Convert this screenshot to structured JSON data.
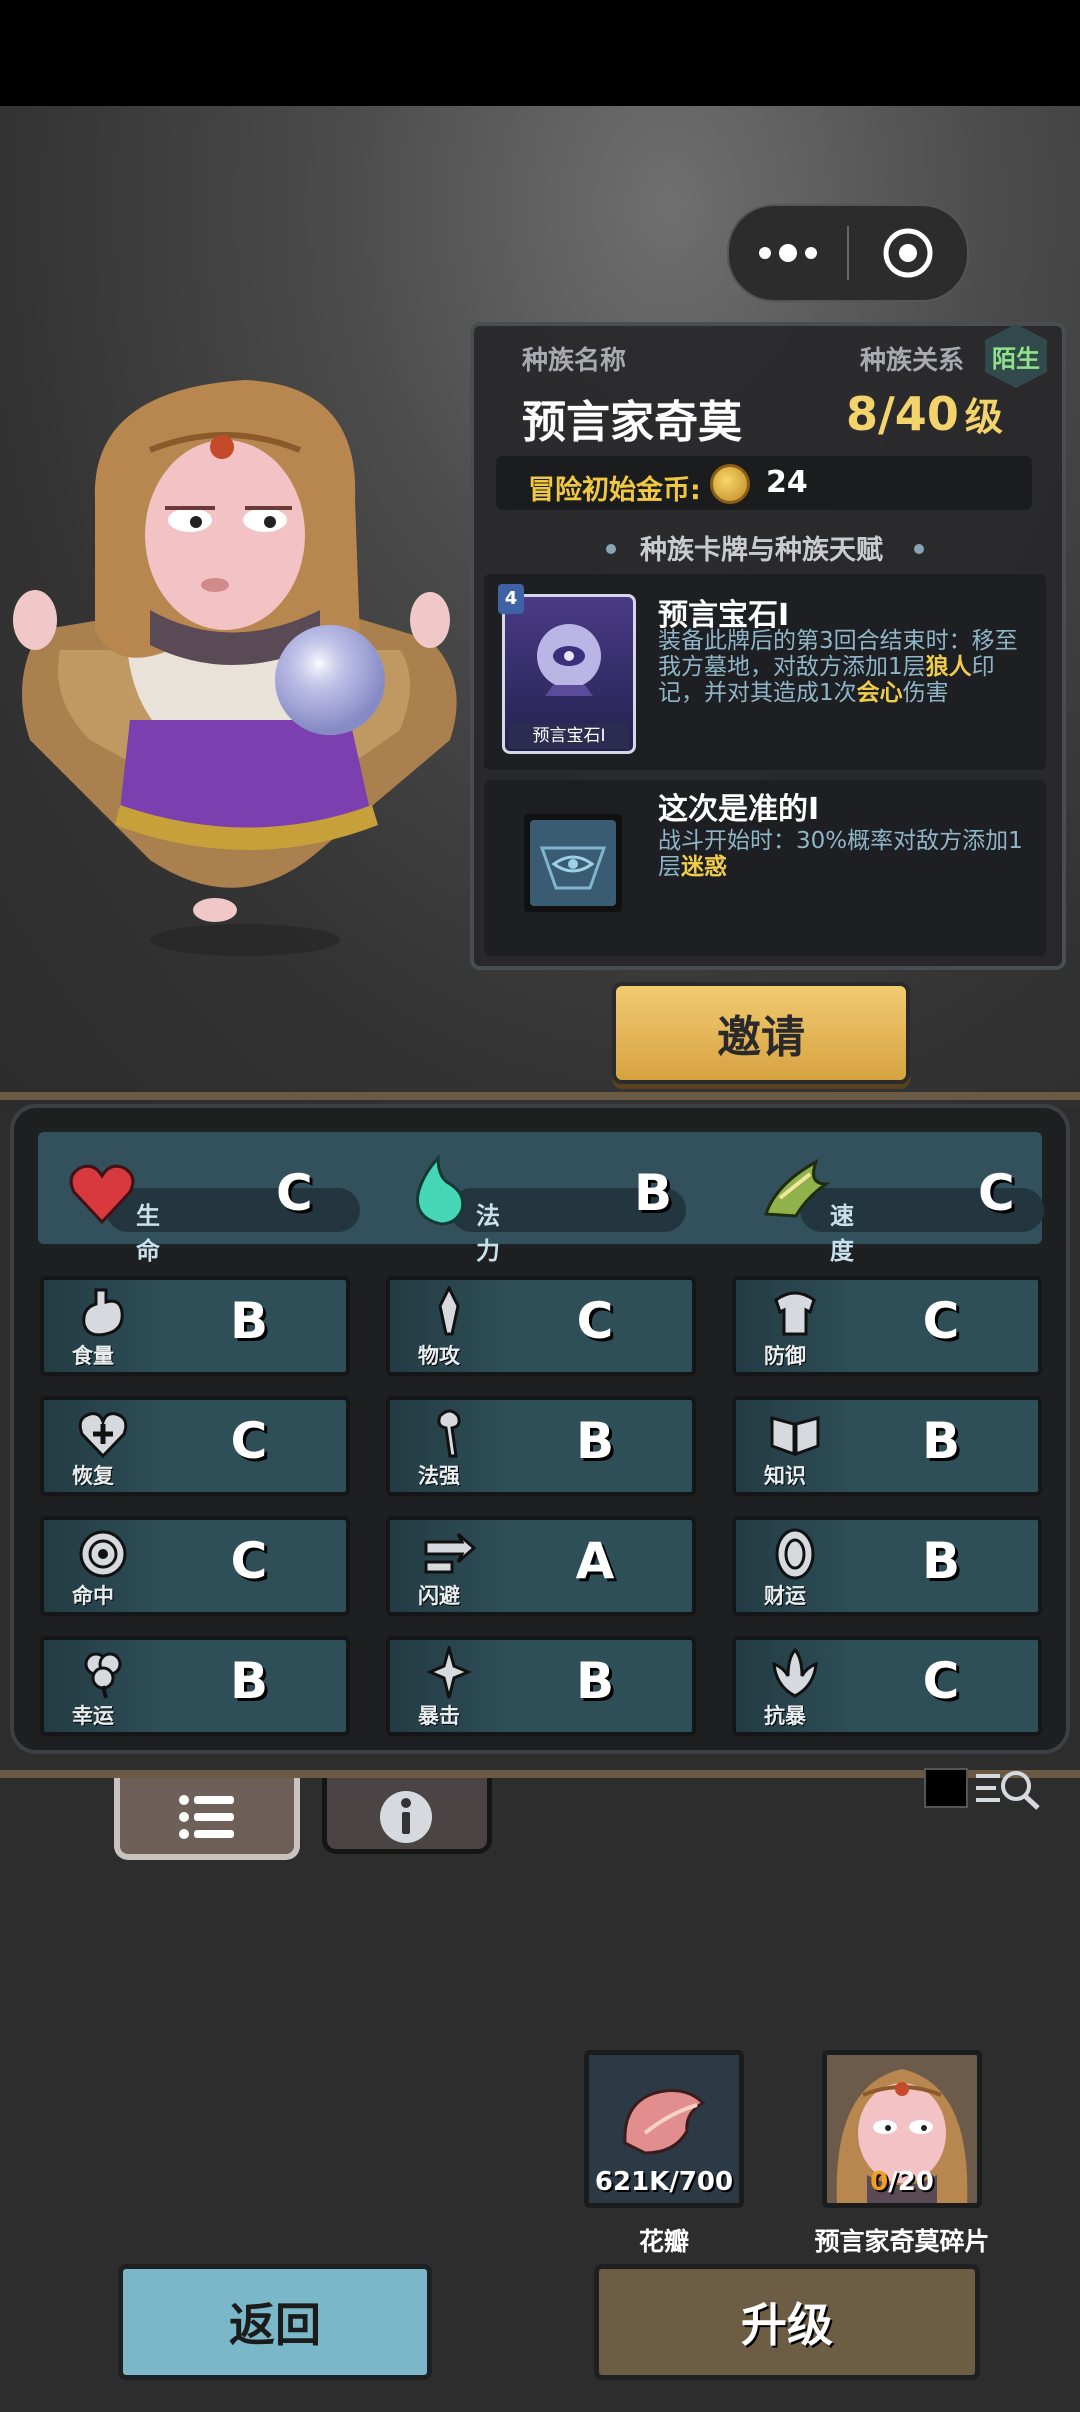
{
  "race": {
    "name_label": "种族名称",
    "name": "预言家奇莫",
    "relation_label": "种族关系",
    "relation": "陌生",
    "level": "8/40",
    "level_unit": "级",
    "coin_label": "冒险初始金币:",
    "coin_value": "24"
  },
  "section_title": "种族卡牌与种族天赋",
  "cards": [
    {
      "cost": "4",
      "thumb_label": "预言宝石I",
      "title": "预言宝石I",
      "desc_parts": [
        "装备此牌后的第3回合结束时：移至我方墓地，对敌方添加1层",
        "狼人",
        "印记，并对其造成1次",
        "会心",
        "伤害"
      ]
    },
    {
      "title": "这次是准的I",
      "desc_parts": [
        "战斗开始时：30%概率对敌方添加1层",
        "迷惑"
      ]
    }
  ],
  "invite_label": "邀请",
  "main_stats": [
    {
      "name": "生命",
      "grade": "C",
      "icon": "heart-icon"
    },
    {
      "name": "法力",
      "grade": "B",
      "icon": "flame-icon"
    },
    {
      "name": "速度",
      "grade": "C",
      "icon": "wing-icon"
    }
  ],
  "stats": [
    {
      "name": "食量",
      "grade": "B",
      "icon": "stomach-icon"
    },
    {
      "name": "物攻",
      "grade": "C",
      "icon": "blade-icon"
    },
    {
      "name": "防御",
      "grade": "C",
      "icon": "armor-icon"
    },
    {
      "name": "恢复",
      "grade": "C",
      "icon": "heal-heart-icon"
    },
    {
      "name": "法强",
      "grade": "B",
      "icon": "staff-icon"
    },
    {
      "name": "知识",
      "grade": "B",
      "icon": "book-icon"
    },
    {
      "name": "命中",
      "grade": "C",
      "icon": "target-icon"
    },
    {
      "name": "闪避",
      "grade": "A",
      "icon": "dodge-arrows-icon"
    },
    {
      "name": "财运",
      "grade": "B",
      "icon": "coin-icon"
    },
    {
      "name": "幸运",
      "grade": "B",
      "icon": "clover-icon"
    },
    {
      "name": "暴击",
      "grade": "B",
      "icon": "crit-sword-icon"
    },
    {
      "name": "抗暴",
      "grade": "C",
      "icon": "shield-flower-icon"
    }
  ],
  "items": [
    {
      "count": "621K/700",
      "name": "花瓣",
      "icon": "petal-icon"
    },
    {
      "count_have": "0",
      "count_need": "/20",
      "name": "预言家奇莫碎片",
      "icon": "character-portrait"
    }
  ],
  "back_label": "返回",
  "upgrade_label": "升级",
  "colors": {
    "gold": "#f3d36c",
    "teal_panel": "#2e4e58",
    "back_button": "#7ab8c9",
    "upgrade_button": "#6d5d45"
  }
}
